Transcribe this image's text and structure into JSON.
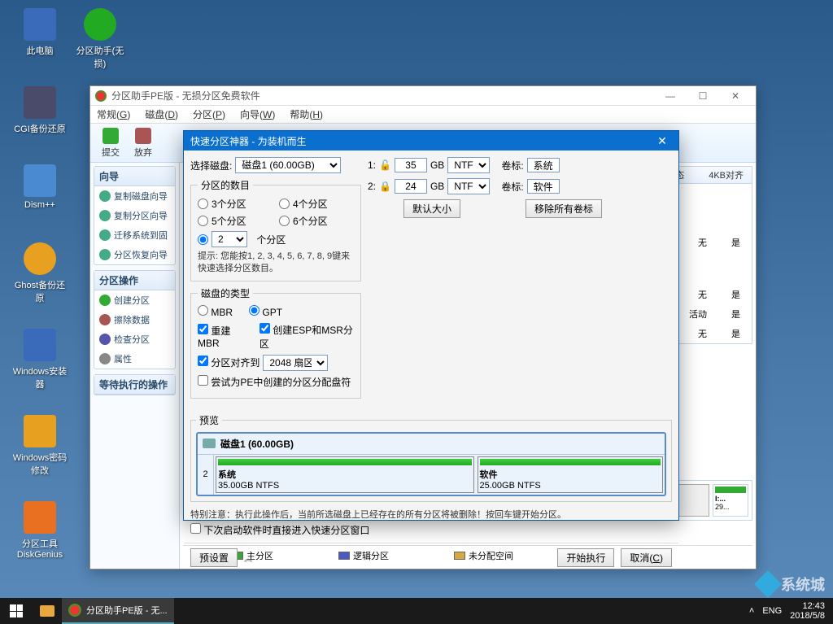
{
  "desktop_icons": [
    {
      "label": "此电脑",
      "color": "#3a6aba"
    },
    {
      "label": "分区助手(无损)",
      "color": "#2a2"
    },
    {
      "label": "CGI备份还原",
      "color": "#4a4a6a"
    },
    {
      "label": "Dism++",
      "color": "#4a8ad0"
    },
    {
      "label": "Ghost备份还原",
      "color": "#e8a020"
    },
    {
      "label": "Windows安装器",
      "color": "#3a6aba"
    },
    {
      "label": "Windows密码修改",
      "color": "#e8a020"
    },
    {
      "label": "分区工具DiskGenius",
      "color": "#e87020"
    }
  ],
  "main_window": {
    "title": "分区助手PE版 - 无损分区免费软件",
    "menu": [
      {
        "text": "常规(G)",
        "u": "G"
      },
      {
        "text": "磁盘(D)",
        "u": "D"
      },
      {
        "text": "分区(P)",
        "u": "P"
      },
      {
        "text": "向导(W)",
        "u": "W"
      },
      {
        "text": "帮助(H)",
        "u": "H"
      }
    ],
    "toolbar": [
      {
        "label": "提交"
      },
      {
        "label": "放弃"
      }
    ],
    "sidebar": {
      "groups": [
        {
          "title": "向导",
          "items": [
            "复制磁盘向导",
            "复制分区向导",
            "迁移系统到固",
            "分区恢复向导"
          ]
        },
        {
          "title": "分区操作",
          "items": [
            "创建分区",
            "擦除数据",
            "检查分区",
            "属性"
          ]
        }
      ],
      "pending_title": "等待执行的操作"
    },
    "columns": [
      "状态",
      "4KB对齐"
    ],
    "rows": [
      [
        "无",
        "是"
      ],
      [
        "无",
        "是"
      ],
      [
        "活动",
        "是"
      ],
      [
        "无",
        "是"
      ]
    ],
    "small_disk": {
      "label": "I:...",
      "size": "29..."
    },
    "legend": [
      {
        "label": "主分区",
        "color": "#3aa33a"
      },
      {
        "label": "逻辑分区",
        "color": "#4a5ac5"
      },
      {
        "label": "未分配空间",
        "color": "#d8a840"
      }
    ]
  },
  "dialog": {
    "title": "快速分区神器 - 为装机而生",
    "select_disk_label": "选择磁盘:",
    "select_disk_value": "磁盘1 (60.00GB)",
    "partition_count_label": "分区的数目",
    "count_options": [
      "3个分区",
      "4个分区",
      "5个分区",
      "6个分区"
    ],
    "count_custom_value": "2",
    "count_custom_suffix": "个分区",
    "hint": "提示: 您能按1, 2, 3, 4, 5, 6, 7, 8, 9键来快速选择分区数目。",
    "disk_type_label": "磁盘的类型",
    "type_options": [
      "MBR",
      "GPT"
    ],
    "rebuild_mbr": "重建MBR",
    "create_esp": "创建ESP和MSR分区",
    "align_label": "分区对齐到",
    "align_value": "2048 扇区",
    "try_pe": "尝试为PE中创建的分区分配盘符",
    "part_rows": [
      {
        "num": "1:",
        "size": "35",
        "unit": "GB",
        "fs": "NTFS",
        "vol_label": "卷标:",
        "vol": "系统"
      },
      {
        "num": "2:",
        "size": "24",
        "unit": "GB",
        "fs": "NTFS",
        "vol_label": "卷标:",
        "vol": "软件"
      }
    ],
    "default_size_btn": "默认大小",
    "remove_labels_btn": "移除所有卷标",
    "preview_label": "预览",
    "preview_disk": "磁盘1  (60.00GB)",
    "preview_parts": [
      {
        "name": "系统",
        "detail": "35.00GB NTFS",
        "flex": 35
      },
      {
        "name": "软件",
        "detail": "25.00GB NTFS",
        "flex": 25
      }
    ],
    "preview_num": "2",
    "warning": "特别注意：执行此操作后，当前所选磁盘上已经存在的所有分区将被删除！按回车键开始分区。",
    "next_boot": "下次启动软件时直接进入快速分区窗口",
    "preset_btn": "预设置",
    "start_btn": "开始执行",
    "cancel_btn": "取消(C)"
  },
  "taskbar": {
    "app_label": "分区助手PE版 - 无...",
    "lang": "ENG",
    "time": "12:43",
    "date": "2018/5/8"
  },
  "watermark": "系统城"
}
